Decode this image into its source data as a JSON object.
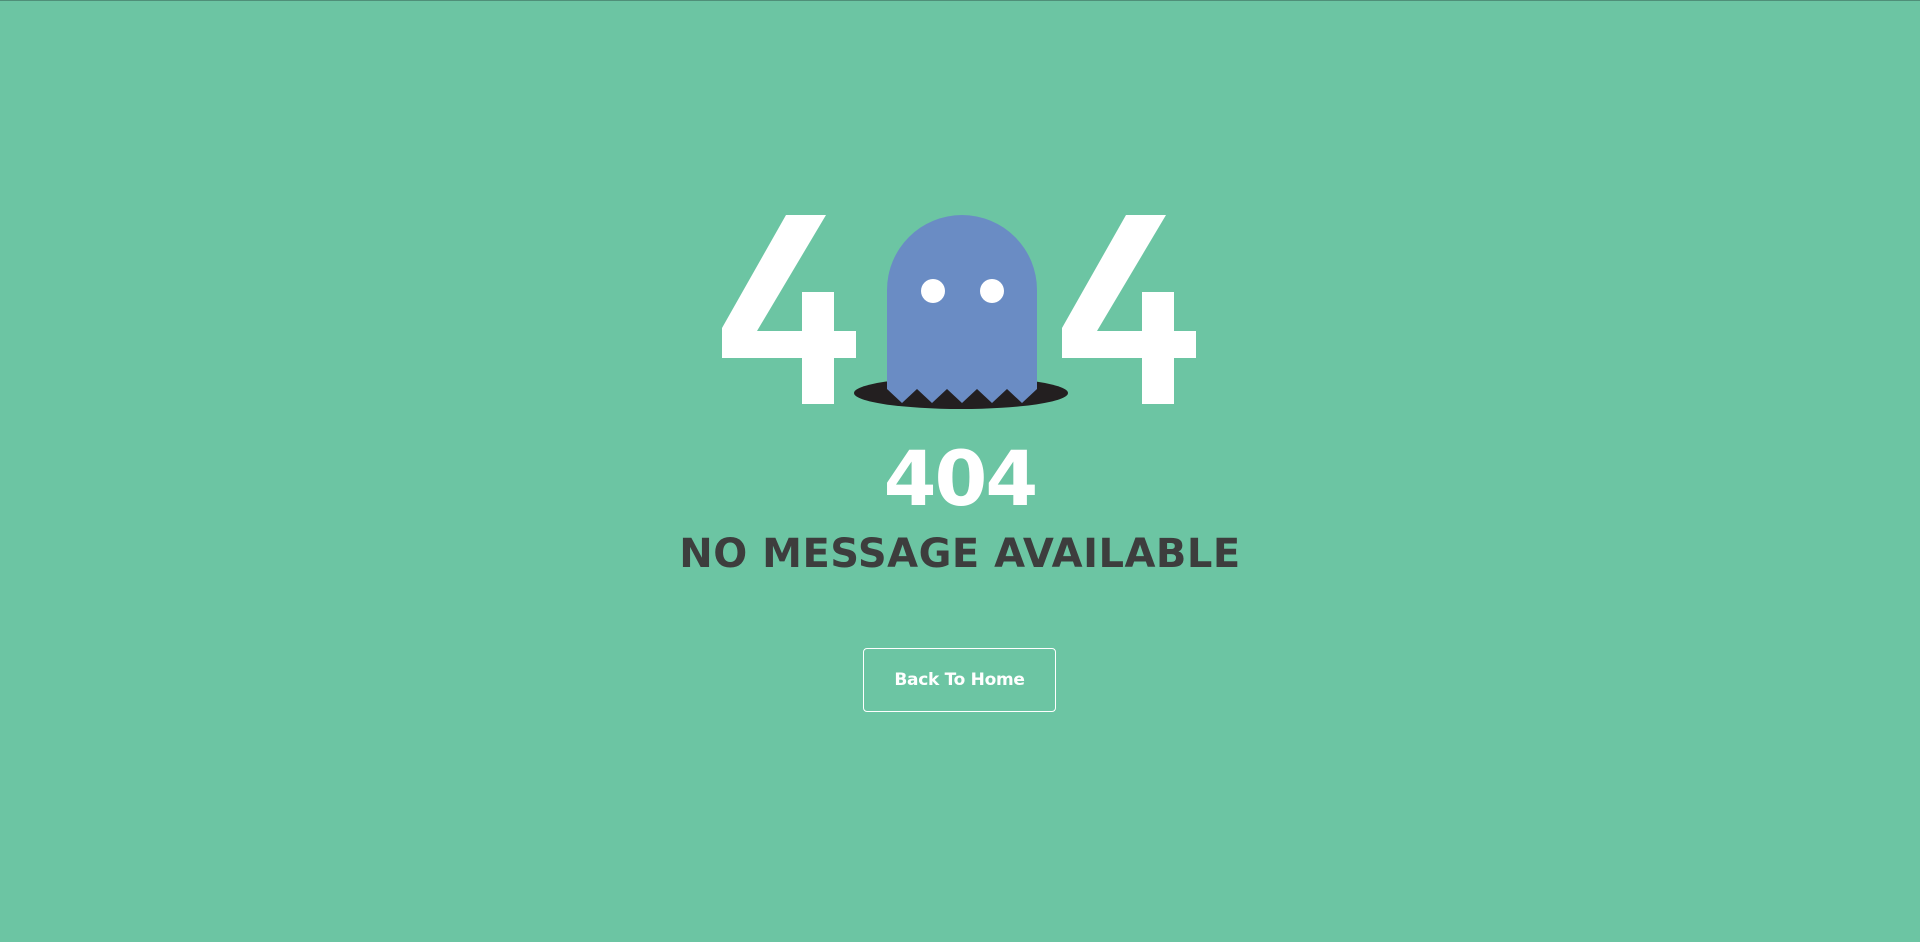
{
  "illustration": {
    "left_digit": "4",
    "right_digit": "4",
    "icon": "ghost-icon",
    "ghost_color": "#6a8cc4",
    "hole_color": "#231f20",
    "digit_color": "#ffffff"
  },
  "error": {
    "code": "404",
    "message": "NO MESSAGE AVAILABLE"
  },
  "actions": {
    "home_label": "Back To Home"
  },
  "colors": {
    "background": "#6cc5a3",
    "message": "#3d3d3d",
    "button_border": "#ffffff"
  }
}
